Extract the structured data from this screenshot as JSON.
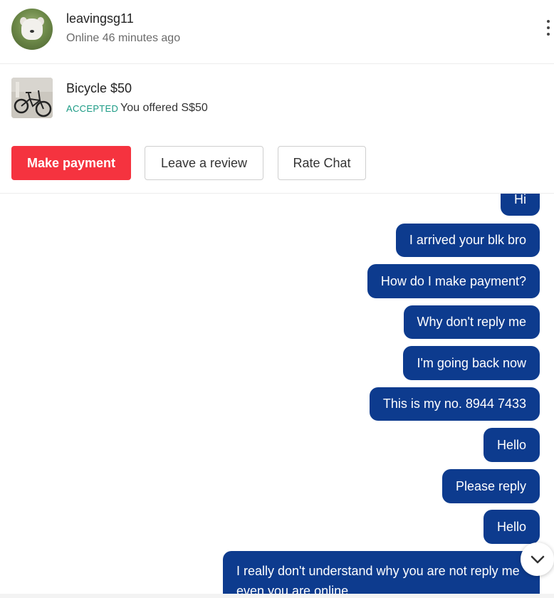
{
  "header": {
    "username": "leavingsg11",
    "status": "Online 46 minutes ago",
    "avatar_icon": "dog-avatar",
    "menu_icon": "more-vertical-icon"
  },
  "listing": {
    "title": "Bicycle $50",
    "badge": "ACCEPTED",
    "offer": "You offered S$50",
    "thumbnail_icon": "bicycle-image"
  },
  "actions": {
    "make_payment": "Make payment",
    "leave_review": "Leave a review",
    "rate_chat": "Rate Chat"
  },
  "messages": [
    {
      "text": "Hi"
    },
    {
      "text": "I arrived your blk bro"
    },
    {
      "text": "How do I make payment?"
    },
    {
      "text": "Why don't reply me"
    },
    {
      "text": "I'm going back now"
    },
    {
      "text": "This is my no. 8944 7433"
    },
    {
      "text": "Hello"
    },
    {
      "text": "Please reply"
    },
    {
      "text": "Hello"
    },
    {
      "text": "I really don't understand why you are not reply me even you are online."
    }
  ],
  "colors": {
    "primary": "#f5333f",
    "bubble": "#0d3b8e",
    "accepted": "#1a9a84"
  }
}
